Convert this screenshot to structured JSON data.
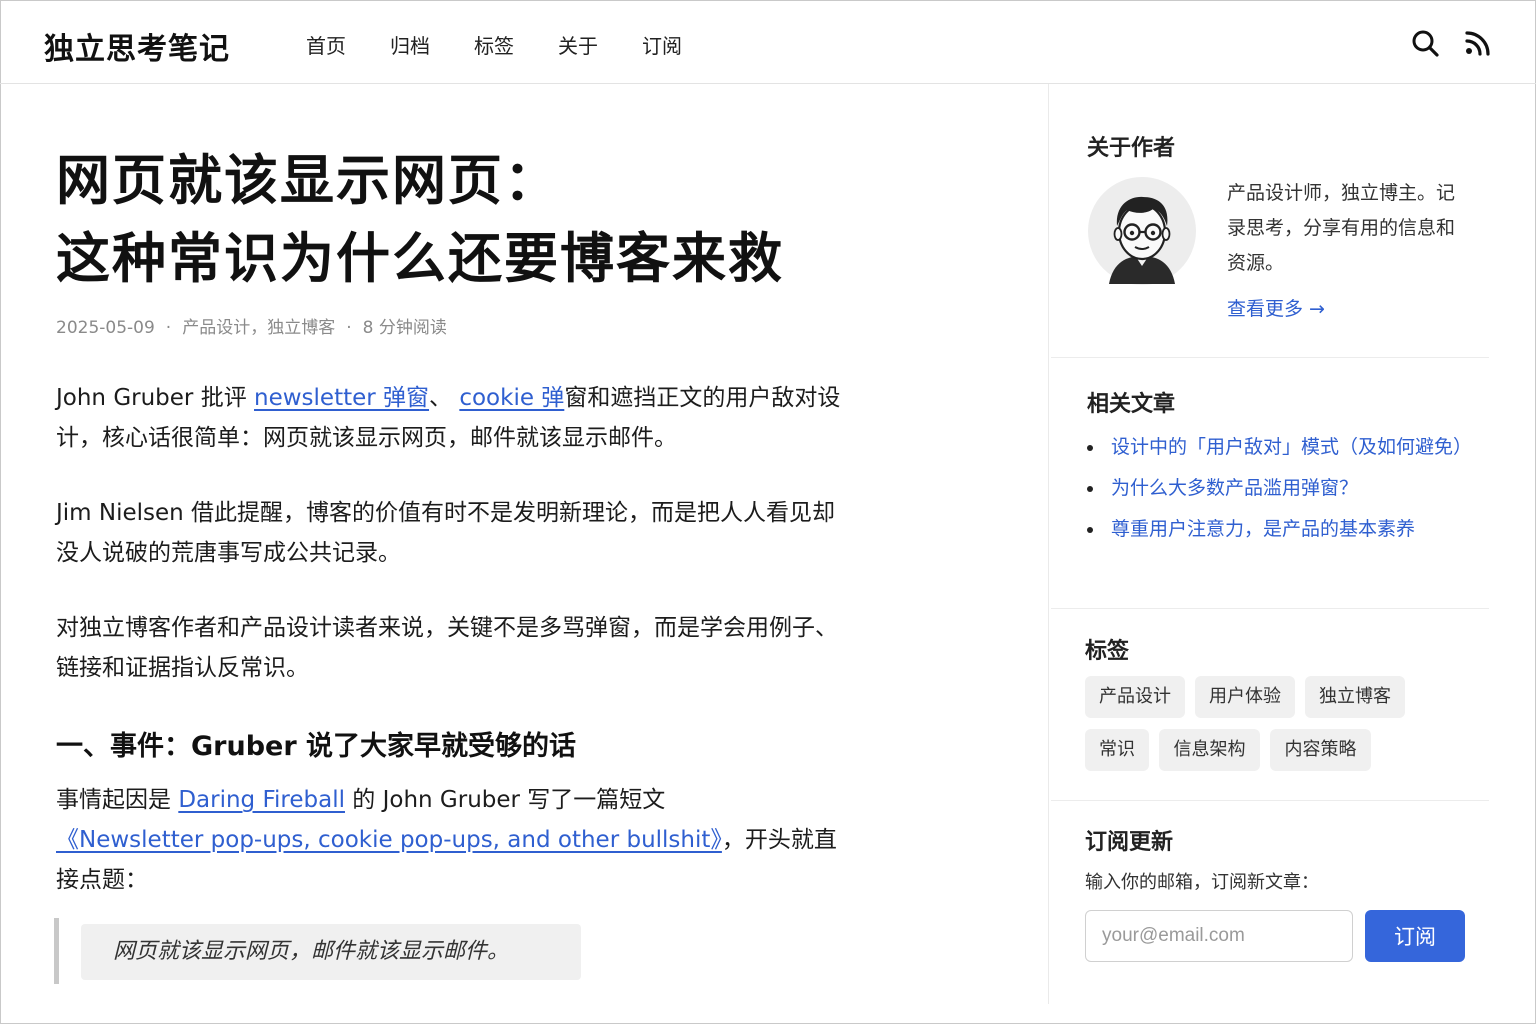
{
  "header": {
    "logo": "独立思考笔记",
    "nav": [
      "首页",
      "归档",
      "标签",
      "关于",
      "订阅"
    ]
  },
  "article": {
    "title_line1": "网页就该显示网页：",
    "title_line2": "这种常识为什么还要博客来救",
    "meta": {
      "date": "2025-05-09",
      "categories": "产品设计，独立博客",
      "read_time": "8 分钟阅读",
      "separator": "·"
    },
    "p1": {
      "a": "John  Gruber 批评 ",
      "link1": "newsletter 弹窗",
      "b": "、 ",
      "link2": "cookie 弹",
      "c": "窗和遮挡正文的用户敌对设计，核心话很简单：网页就该显示网页，邮件就该显示邮件。"
    },
    "p2": "Jim Nielsen 借此提醒，博客的价值有时不是发明新理论，而是把人人看见却没人说破的荒唐事写成公共记录。",
    "p3": "对独立博客作者和产品设计读者来说，关键不是多骂弹窗，而是学会用例子、链接和证据指认反常识。",
    "h2": "一、事件：Gruber 说了大家早就受够的话",
    "p4": {
      "a": "事情起因是 ",
      "link1": "Daring Fireball",
      "b": " 的 John Gruber 写了一篇短文",
      "link2": "《Newsletter pop-ups, cookie pop-ups, and other bullshit》",
      "c": "，开头就直接点题："
    },
    "quote": "网页就该显示网页，邮件就该显示邮件。"
  },
  "sidebar": {
    "about": {
      "heading": "关于作者",
      "bio": "产品设计师，独立博主。记录思考，分享有用的信息和资源。",
      "more": "查看更多 →"
    },
    "related": {
      "heading": "相关文章",
      "items": [
        "设计中的「用户敌对」模式（及如何避免）",
        "为什么大多数产品滥用弹窗？",
        "尊重用户注意力，是产品的基本素养"
      ]
    },
    "tags": {
      "heading": "标签",
      "items": [
        "产品设计",
        "用户体验",
        "独立博客",
        "常识",
        "信息架构",
        "内容策略"
      ]
    },
    "subscribe": {
      "heading": "订阅更新",
      "desc": "输入你的邮箱，订阅新文章：",
      "placeholder": "your@email.com",
      "button": "订阅"
    }
  },
  "colors": {
    "link": "#2f5fd0",
    "button": "#3566db",
    "meta": "#8a8a8a"
  }
}
